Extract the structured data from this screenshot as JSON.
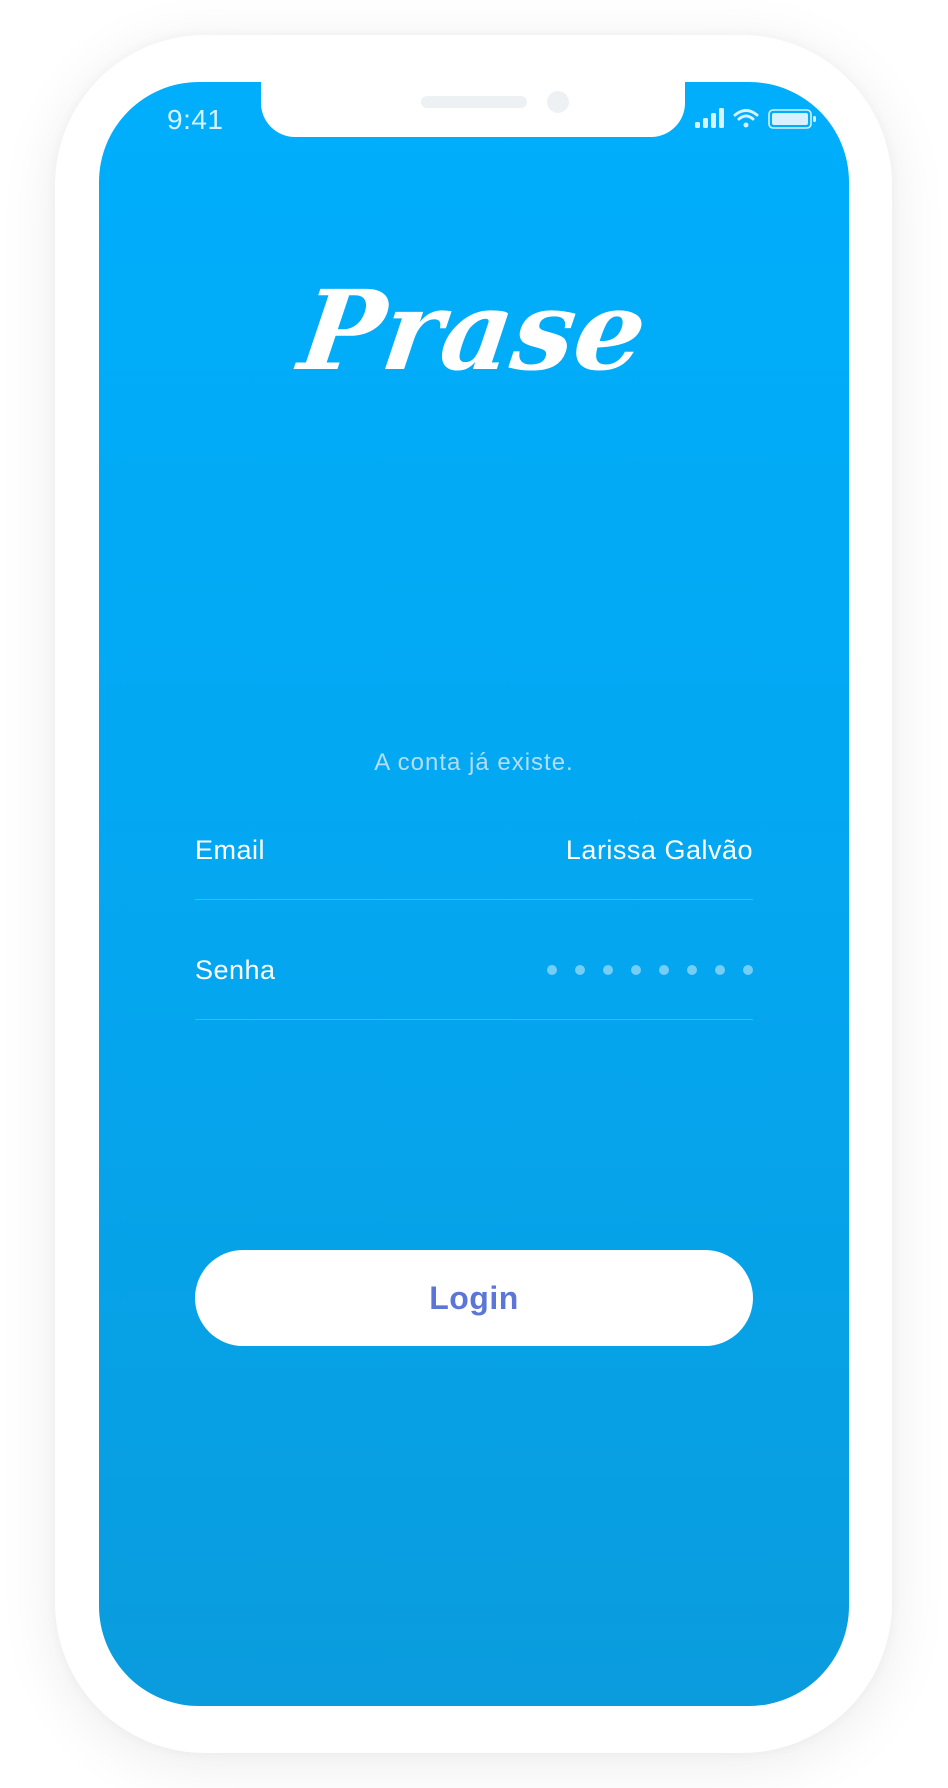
{
  "status_bar": {
    "time": "9:41",
    "icons": [
      "signal-icon",
      "wifi-icon",
      "battery-icon"
    ]
  },
  "app": {
    "logo_text": "Prase"
  },
  "message": "A conta já existe.",
  "form": {
    "email_label": "Email",
    "email_value": "Larissa Galvão",
    "password_label": "Senha",
    "password_dot_count": 8
  },
  "login_button_label": "Login",
  "colors": {
    "gradient_top": "#00aefc",
    "gradient_bottom": "#0a9cdd",
    "button_text": "#5a76d6",
    "text_primary": "#ffffff",
    "text_muted": "#b3def4"
  }
}
